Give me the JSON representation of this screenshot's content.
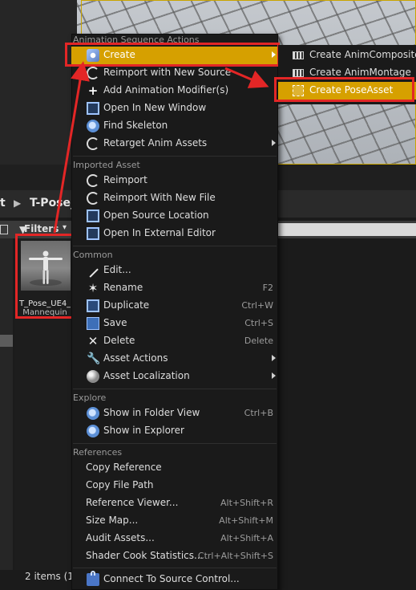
{
  "background": {
    "breadcrumb_prefix": "t",
    "breadcrumb_current": "T-Pose_",
    "filters_label": "Filters",
    "asset": {
      "name_line1": "T_Pose_UE4_",
      "name_line2": "Mannequin"
    },
    "item_count": "2 items (1"
  },
  "context_menu": {
    "animation_section": "Animation Sequence Actions",
    "animation_items": [
      {
        "label": "Create",
        "icon": "animation-icon",
        "submenu": true,
        "highlighted": true
      },
      {
        "label": "Reimport with New Source",
        "icon": "reimport-icon"
      },
      {
        "label": "Add Animation Modifier(s)",
        "icon": "plus-icon"
      },
      {
        "label": "Open In New Window",
        "icon": "window-icon"
      },
      {
        "label": "Find Skeleton",
        "icon": "search-icon"
      },
      {
        "label": "Retarget Anim Assets",
        "icon": "retarget-icon",
        "submenu": true
      }
    ],
    "imported_section": "Imported Asset",
    "imported_items": [
      {
        "label": "Reimport",
        "icon": "reimport-icon"
      },
      {
        "label": "Reimport With New File",
        "icon": "reimport-icon"
      },
      {
        "label": "Open Source Location",
        "icon": "folder-icon"
      },
      {
        "label": "Open In External Editor",
        "icon": "external-editor-icon"
      }
    ],
    "common_section": "Common",
    "common_items": [
      {
        "label": "Edit...",
        "icon": "edit-icon"
      },
      {
        "label": "Rename",
        "icon": "rename-icon",
        "shortcut": "F2"
      },
      {
        "label": "Duplicate",
        "icon": "duplicate-icon",
        "shortcut": "Ctrl+W"
      },
      {
        "label": "Save",
        "icon": "save-icon",
        "shortcut": "Ctrl+S"
      },
      {
        "label": "Delete",
        "icon": "delete-icon",
        "shortcut": "Delete"
      },
      {
        "label": "Asset Actions",
        "icon": "wrench-icon",
        "submenu": true
      },
      {
        "label": "Asset Localization",
        "icon": "globe-icon",
        "submenu": true
      }
    ],
    "explore_section": "Explore",
    "explore_items": [
      {
        "label": "Show in Folder View",
        "icon": "search-icon",
        "shortcut": "Ctrl+B"
      },
      {
        "label": "Show in Explorer",
        "icon": "search-icon"
      }
    ],
    "references_section": "References",
    "references_items": [
      {
        "label": "Copy Reference"
      },
      {
        "label": "Copy File Path"
      },
      {
        "label": "Reference Viewer...",
        "shortcut": "Alt+Shift+R"
      },
      {
        "label": "Size Map...",
        "shortcut": "Alt+Shift+M"
      },
      {
        "label": "Audit Assets...",
        "shortcut": "Alt+Shift+A"
      },
      {
        "label": "Shader Cook Statistics...",
        "shortcut": "Ctrl+Alt+Shift+S"
      }
    ],
    "source_control_item": {
      "label": "Connect To Source Control...",
      "icon": "source-control-icon"
    }
  },
  "create_submenu": {
    "items": [
      {
        "label": "Create AnimComposite",
        "icon": "film-icon"
      },
      {
        "label": "Create AnimMontage",
        "icon": "film-icon"
      },
      {
        "label": "Create PoseAsset",
        "icon": "pose-asset-icon",
        "highlighted": true
      }
    ]
  },
  "colors": {
    "accent": "#d6a000",
    "annotation_red": "#e32626",
    "menu_bg": "#1a1a1a"
  }
}
